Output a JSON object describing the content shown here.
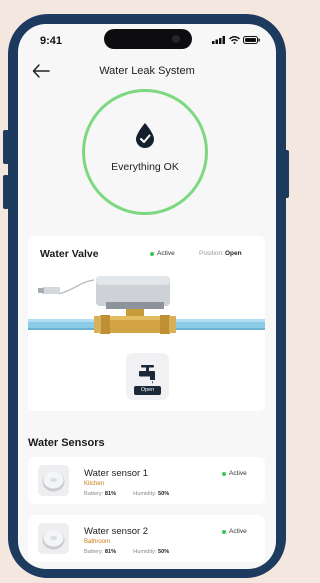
{
  "status_bar": {
    "time": "9:41"
  },
  "header": {
    "title": "Water Leak System"
  },
  "system_status": {
    "text": "Everything OK"
  },
  "valve": {
    "title": "Water Valve",
    "status": "Active",
    "position_label": "Position:",
    "position_value": "Open",
    "button_label": "Open"
  },
  "sensors": {
    "title": "Water Sensors",
    "items": [
      {
        "name": "Water sensor 1",
        "room": "Kitchen",
        "status": "Active",
        "battery_label": "Battery:",
        "battery": "81%",
        "humidity_label": "Humidity:",
        "humidity": "50%"
      },
      {
        "name": "Water sensor 2",
        "room": "Bathroom",
        "status": "Active",
        "battery_label": "Battery:",
        "battery": "81%",
        "humidity_label": "Humidity:",
        "humidity": "50%"
      }
    ]
  },
  "colors": {
    "frame": "#1d3a5f",
    "ok_ring": "#7dd87f",
    "active_dot": "#3cc25c",
    "pipe": "#8ccbe6",
    "room_text": "#c97a10"
  },
  "icons": [
    "back-arrow",
    "water-drop-check",
    "water-valve",
    "faucet",
    "water-sensor"
  ]
}
